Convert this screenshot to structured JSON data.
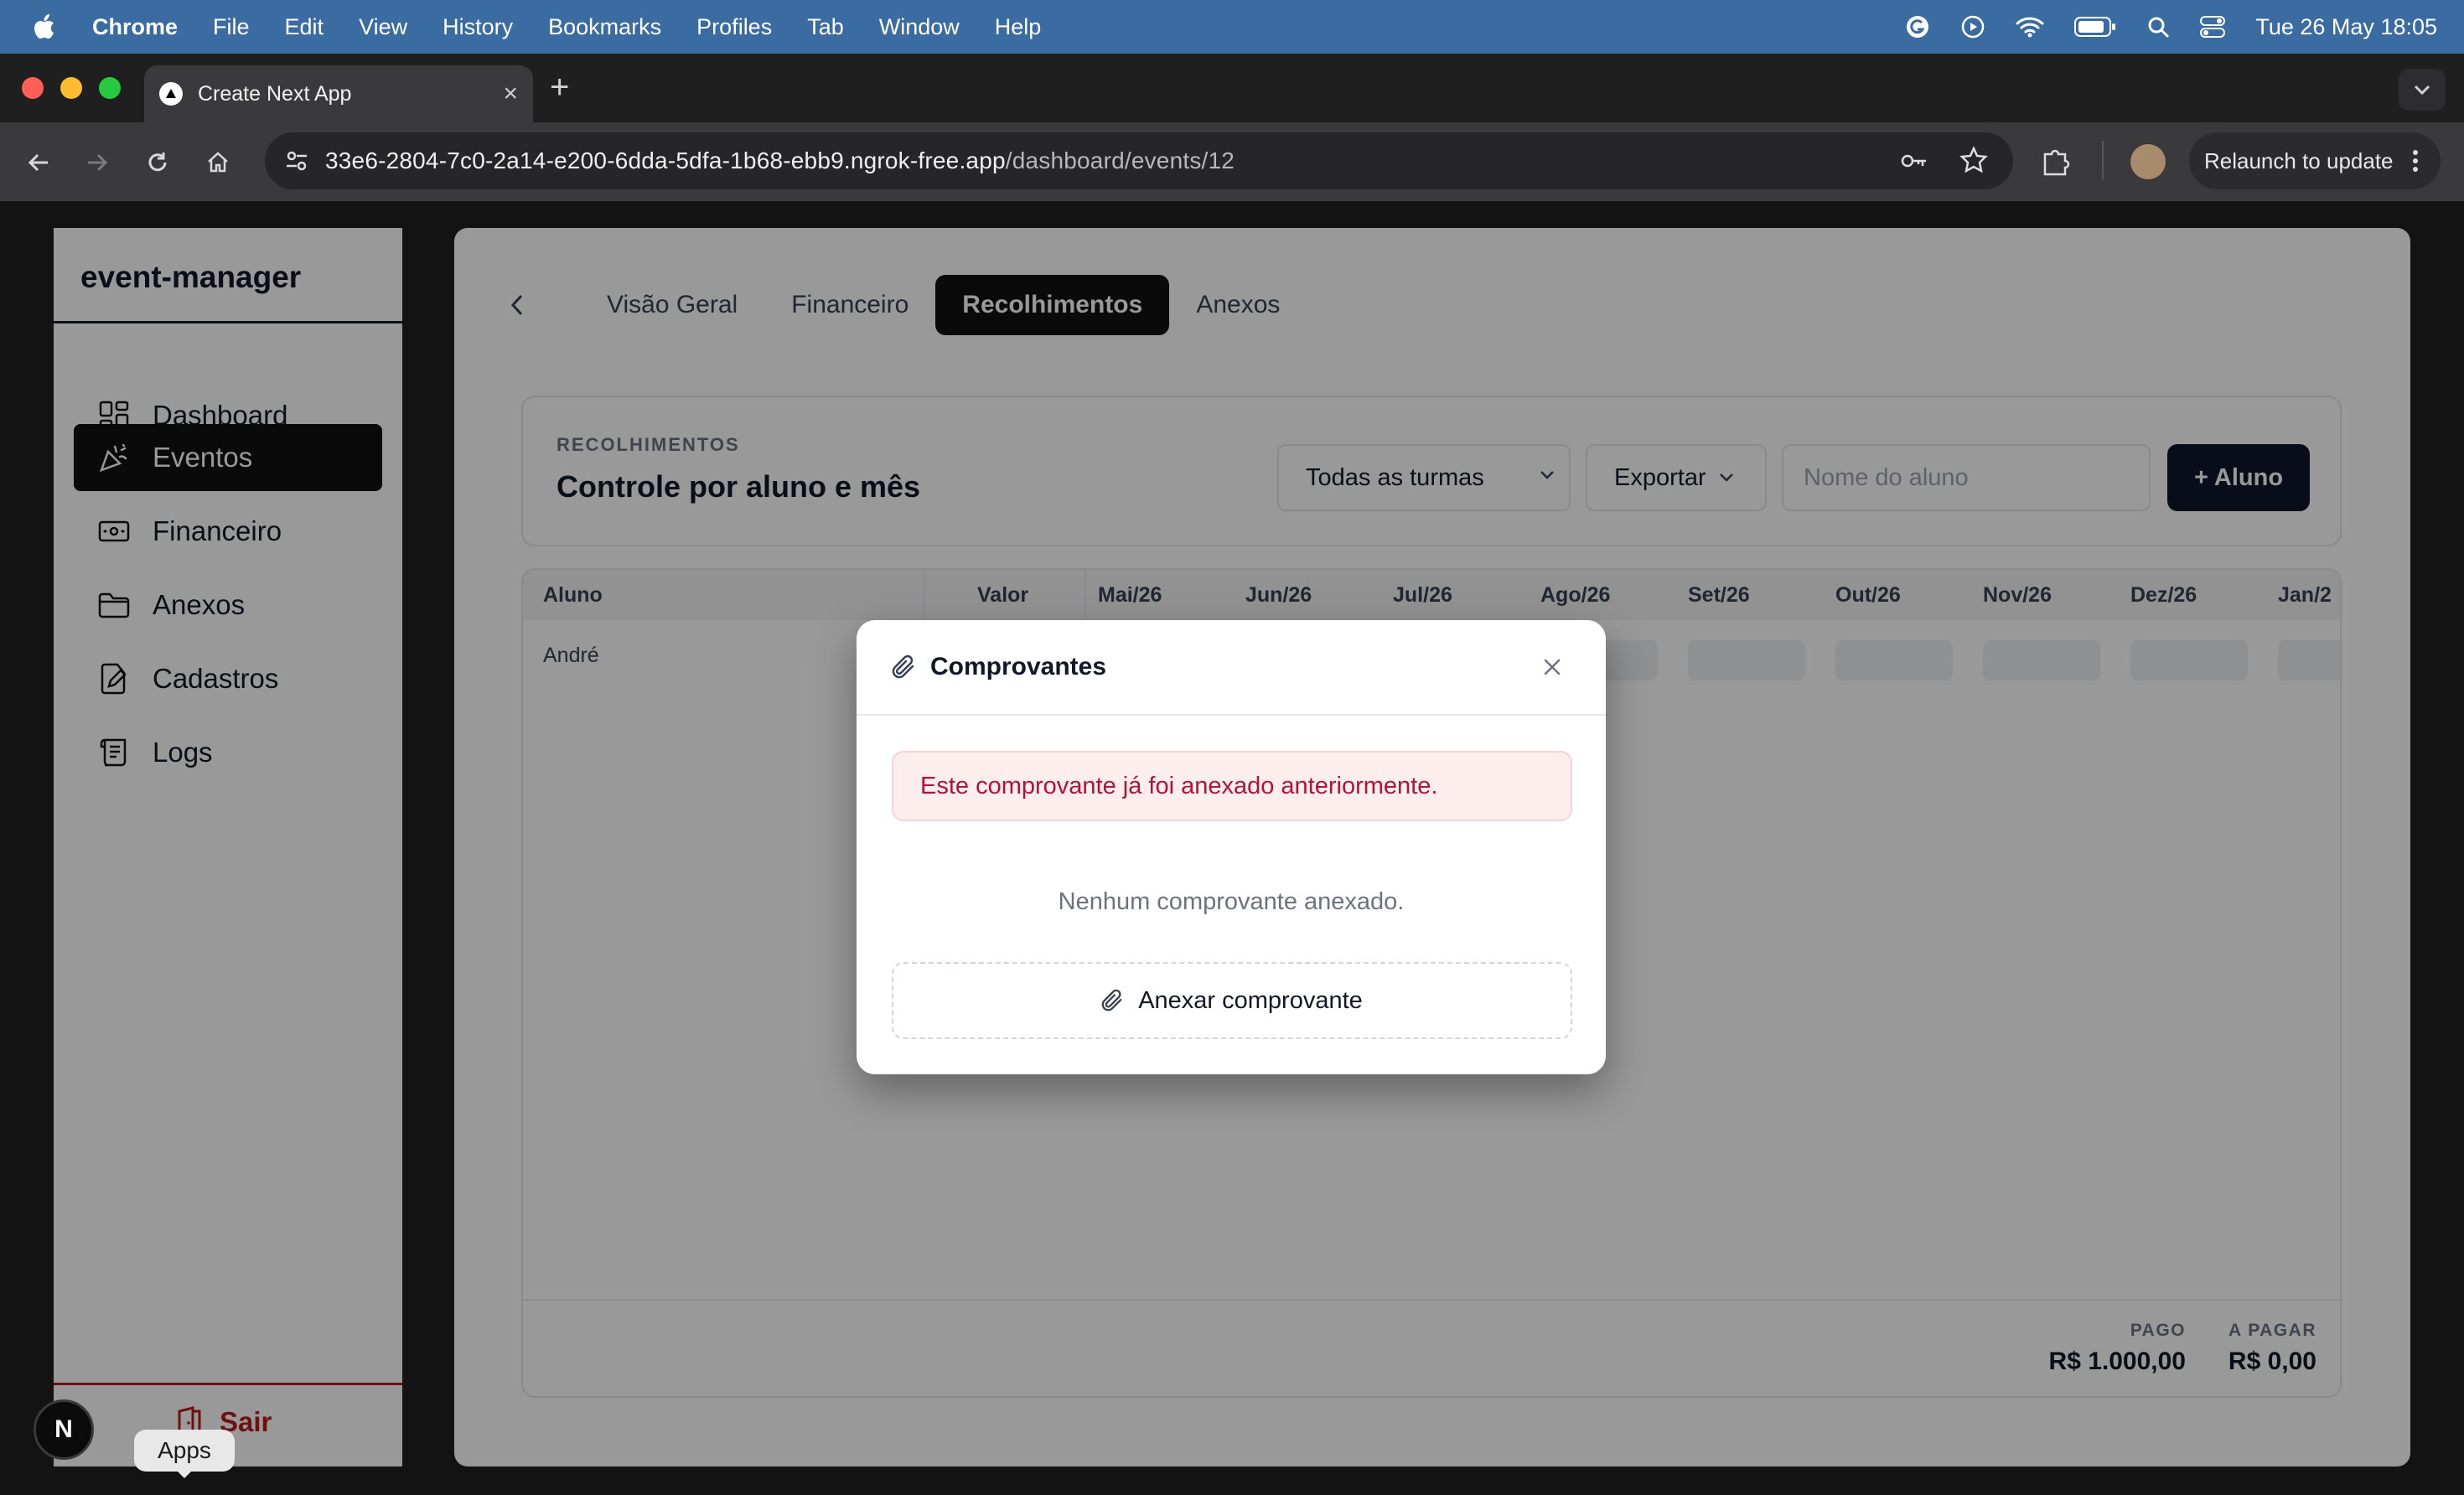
{
  "menubar": {
    "app": "Chrome",
    "items": [
      "File",
      "Edit",
      "View",
      "History",
      "Bookmarks",
      "Profiles",
      "Tab",
      "Window",
      "Help"
    ],
    "clock": "Tue 26 May  18:05"
  },
  "browser": {
    "tab_title": "Create Next App",
    "url_host": "33e6-2804-7c0-2a14-e200-6dda-5dfa-1b68-ebb9.ngrok-free.app",
    "url_path": "/dashboard/events/12",
    "relaunch_label": "Relaunch to update"
  },
  "sidebar": {
    "brand": "event-manager",
    "items": [
      {
        "label": "Dashboard",
        "icon": "dashboard-grid-icon"
      },
      {
        "label": "Eventos",
        "icon": "party-popper-icon",
        "active": true
      },
      {
        "label": "Financeiro",
        "icon": "banknote-icon"
      },
      {
        "label": "Anexos",
        "icon": "folder-icon"
      },
      {
        "label": "Cadastros",
        "icon": "edit-document-icon"
      },
      {
        "label": "Logs",
        "icon": "scroll-icon"
      }
    ],
    "logout_label": "Sair"
  },
  "tabs": {
    "items": [
      "Visão Geral",
      "Financeiro",
      "Recolhimentos",
      "Anexos"
    ],
    "active": "Recolhimentos"
  },
  "card": {
    "kicker": "RECOLHIMENTOS",
    "title": "Controle por aluno e mês",
    "class_select": "Todas as turmas",
    "export_label": "Exportar",
    "search_placeholder": "Nome do aluno",
    "add_label": "+ Aluno"
  },
  "table": {
    "headers": [
      "Aluno",
      "Valor",
      "Mai/26",
      "Jun/26",
      "Jul/26",
      "Ago/26",
      "Set/26",
      "Out/26",
      "Nov/26",
      "Dez/26",
      "Jan/2"
    ],
    "rows": [
      {
        "aluno": "André"
      }
    ],
    "totals": {
      "paid_label": "PAGO",
      "paid_value": "R$ 1.000,00",
      "due_label": "A PAGAR",
      "due_value": "R$ 0,00"
    }
  },
  "modal": {
    "title": "Comprovantes",
    "error": "Este comprovante já foi anexado anteriormente.",
    "empty": "Nenhum comprovante anexado.",
    "attach_label": "Anexar comprovante"
  },
  "dev": {
    "badge": "N",
    "tooltip": "Apps"
  }
}
